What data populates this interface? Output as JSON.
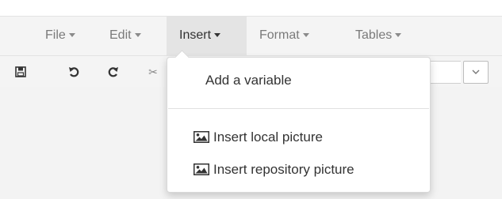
{
  "menubar": {
    "items": [
      {
        "label": "File"
      },
      {
        "label": "Edit"
      },
      {
        "label": "Insert"
      },
      {
        "label": "Format"
      },
      {
        "label": "Tables"
      }
    ]
  },
  "toolbar": {
    "icons": [
      "save-icon",
      "undo-icon",
      "redo-icon",
      "cut-icon",
      "chevron-down-icon"
    ]
  },
  "insert_menu": {
    "items": [
      {
        "label": "Add a variable"
      },
      {
        "label": "Insert local picture",
        "icon": "picture-icon"
      },
      {
        "label": "Insert repository picture",
        "icon": "picture-icon"
      }
    ]
  },
  "colors": {
    "menubar_bg": "#f4f4f4",
    "active_menu_bg": "#e4e4e4",
    "menu_text": "#7a7a7a",
    "dropdown_text": "#333333"
  }
}
